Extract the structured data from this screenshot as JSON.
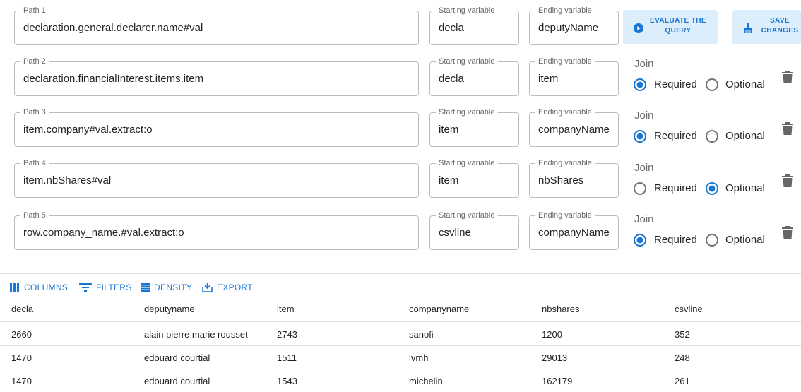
{
  "paths": [
    {
      "label": "Path 1",
      "path": "declaration.general.declarer.name#val",
      "start_label": "Starting variable",
      "start": "decla",
      "end_label": "Ending variable",
      "end": "deputyName"
    },
    {
      "label": "Path 2",
      "path": "declaration.financialInterest.items.item",
      "start_label": "Starting variable",
      "start": "decla",
      "end_label": "Ending variable",
      "end": "item",
      "join_label": "Join",
      "required_label": "Required",
      "optional_label": "Optional",
      "join": "required"
    },
    {
      "label": "Path 3",
      "path": "item.company#val.extract:o",
      "start_label": "Starting variable",
      "start": "item",
      "end_label": "Ending variable",
      "end": "companyName",
      "join_label": "Join",
      "required_label": "Required",
      "optional_label": "Optional",
      "join": "required"
    },
    {
      "label": "Path 4",
      "path": "item.nbShares#val",
      "start_label": "Starting variable",
      "start": "item",
      "end_label": "Ending variable",
      "end": "nbShares",
      "join_label": "Join",
      "required_label": "Required",
      "optional_label": "Optional",
      "join": "optional"
    },
    {
      "label": "Path 5",
      "path": "row.company_name.#val.extract:o",
      "start_label": "Starting variable",
      "start": "csvline",
      "end_label": "Ending variable",
      "end": "companyName",
      "join_label": "Join",
      "required_label": "Required",
      "optional_label": "Optional",
      "join": "required"
    }
  ],
  "buttons": {
    "evaluate_line1": "EVALUATE THE",
    "evaluate_line2": "QUERY",
    "save_line1": "SAVE",
    "save_line2": "CHANGES"
  },
  "toolbar": {
    "columns": "COLUMNS",
    "filters": "FILTERS",
    "density": "DENSITY",
    "export": "EXPORT"
  },
  "table": {
    "headers": [
      "decla",
      "deputyname",
      "item",
      "companyname",
      "nbshares",
      "csvline"
    ],
    "rows": [
      [
        "2660",
        "alain pierre marie rousset",
        "2743",
        "sanofi",
        "1200",
        "352"
      ],
      [
        "1470",
        "edouard courtial",
        "1511",
        "lvmh",
        "29013",
        "248"
      ],
      [
        "1470",
        "edouard courtial",
        "1543",
        "michelin",
        "162179",
        "261"
      ]
    ]
  },
  "colors": {
    "accent": "#1976d2",
    "button_bg": "#dceefc",
    "border": "#c4c4c4"
  }
}
